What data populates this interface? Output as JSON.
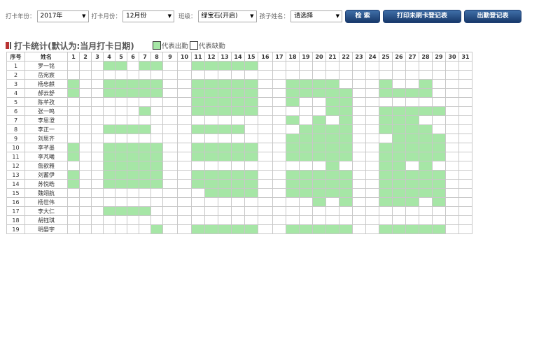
{
  "filters": {
    "year_label": "打卡年份：",
    "year_value": "2017年",
    "month_label": "打卡月份：",
    "month_value": "12月份",
    "class_label": "班级：",
    "class_value": "绿宝石(开启)",
    "child_label": "孩子姓名：",
    "child_value": "请选择"
  },
  "buttons": {
    "search": "检 索",
    "print_missing": "打印未刷卡登记表",
    "attendance_register": "出勤登记表"
  },
  "section": {
    "title": "打卡统计(默认为:当月打卡日期)",
    "legend_present": "代表出勤",
    "legend_absent": "代表缺勤"
  },
  "colors": {
    "present": "#a6e6a6",
    "absent": "#ffffff",
    "button_top": "#3f6fa8",
    "button_bottom": "#17386a"
  },
  "table": {
    "header_index": "序号",
    "header_name": "姓名",
    "days": [
      "1",
      "2",
      "3",
      "4",
      "5",
      "6",
      "7",
      "8",
      "9",
      "10",
      "11",
      "12",
      "13",
      "14",
      "15",
      "16",
      "17",
      "18",
      "19",
      "20",
      "21",
      "22",
      "23",
      "24",
      "25",
      "26",
      "27",
      "28",
      "29",
      "30",
      "31"
    ],
    "rows": [
      {
        "index": "1",
        "name": "罗一铭",
        "present": [
          4,
          5,
          7,
          8,
          11,
          12,
          13,
          14,
          15
        ]
      },
      {
        "index": "2",
        "name": "岳宛宸",
        "present": []
      },
      {
        "index": "3",
        "name": "杨忠麒",
        "present": [
          1,
          4,
          5,
          6,
          7,
          8,
          11,
          12,
          13,
          14,
          15,
          18,
          19,
          20,
          21,
          25,
          28
        ]
      },
      {
        "index": "4",
        "name": "郝云舒",
        "present": [
          1,
          4,
          5,
          6,
          7,
          8,
          11,
          12,
          13,
          14,
          15,
          18,
          19,
          20,
          21,
          22,
          25,
          26,
          27,
          28
        ]
      },
      {
        "index": "5",
        "name": "陈芊孜",
        "present": [
          11,
          12,
          13,
          14,
          15,
          18,
          21,
          22
        ]
      },
      {
        "index": "6",
        "name": "张一鸣",
        "present": [
          7,
          11,
          12,
          13,
          14,
          15,
          21,
          22,
          25,
          26,
          27,
          28,
          29
        ]
      },
      {
        "index": "7",
        "name": "李思澄",
        "present": [
          18,
          20,
          22,
          25,
          26,
          27
        ]
      },
      {
        "index": "8",
        "name": "李正一",
        "present": [
          4,
          5,
          6,
          7,
          11,
          12,
          13,
          14,
          19,
          20,
          21,
          22,
          25,
          26,
          27,
          28
        ]
      },
      {
        "index": "9",
        "name": "刘思齐",
        "present": [
          18,
          19,
          20,
          21,
          22,
          26,
          27,
          28,
          29
        ]
      },
      {
        "index": "10",
        "name": "李芊墨",
        "present": [
          1,
          4,
          5,
          6,
          7,
          8,
          11,
          12,
          13,
          14,
          15,
          18,
          19,
          20,
          21,
          22,
          25,
          26,
          27,
          28,
          29
        ]
      },
      {
        "index": "11",
        "name": "李芃曦",
        "present": [
          1,
          4,
          5,
          6,
          7,
          8,
          11,
          12,
          13,
          14,
          15,
          18,
          19,
          20,
          21,
          22,
          25,
          26,
          27,
          28,
          29
        ]
      },
      {
        "index": "12",
        "name": "詹歆雅",
        "present": [
          4,
          5,
          6,
          7,
          8,
          21,
          25,
          26,
          28
        ]
      },
      {
        "index": "13",
        "name": "刘蓄伊",
        "present": [
          1,
          4,
          5,
          6,
          7,
          8,
          11,
          12,
          13,
          14,
          15,
          18,
          19,
          20,
          21,
          22,
          25,
          26,
          27,
          28,
          29
        ]
      },
      {
        "index": "14",
        "name": "苏悦皓",
        "present": [
          1,
          4,
          5,
          6,
          7,
          8,
          11,
          12,
          13,
          14,
          15,
          18,
          19,
          20,
          21,
          22,
          25,
          26,
          27,
          28,
          29
        ]
      },
      {
        "index": "15",
        "name": "魏翊航",
        "present": [
          12,
          13,
          14,
          15,
          18,
          19,
          20,
          21,
          22,
          25,
          26,
          27,
          28,
          29
        ]
      },
      {
        "index": "16",
        "name": "杨世伟",
        "present": [
          20,
          22,
          25,
          26,
          27,
          29
        ]
      },
      {
        "index": "17",
        "name": "李大仁",
        "present": [
          4,
          5,
          6,
          7
        ]
      },
      {
        "index": "18",
        "name": "胡钰琪",
        "present": []
      },
      {
        "index": "19",
        "name": "明晏宇",
        "present": [
          8,
          11,
          12,
          13,
          14,
          15,
          18,
          19,
          20,
          21,
          22,
          25,
          26,
          27,
          28,
          29
        ]
      }
    ]
  }
}
